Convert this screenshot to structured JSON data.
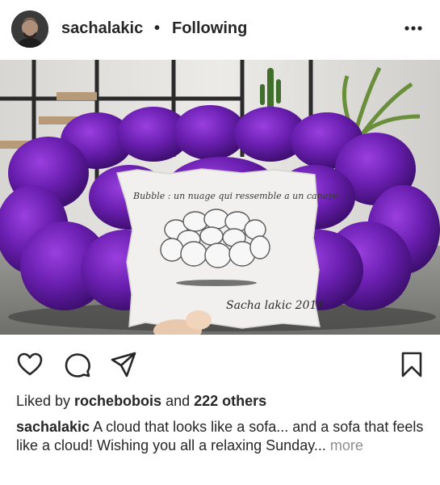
{
  "post": {
    "username": "sachalakic",
    "separator": "•",
    "follow_status": "Following",
    "more_icon": "ellipsis-icon",
    "image_handwriting": "Bubble : un nuage qui ressemble a un canapé ...",
    "image_signature": "Sacha lakic 2014"
  },
  "actions": {
    "like_icon": "heart-icon",
    "comment_icon": "comment-icon",
    "share_icon": "send-icon",
    "save_icon": "bookmark-icon"
  },
  "likes": {
    "prefix": "Liked by ",
    "user": "rochebobois",
    "middle": " and ",
    "others": "222 others"
  },
  "caption": {
    "user": "sachalakic",
    "text": " A cloud that looks like a sofa... and a sofa that feels like a cloud! Wishing you all a relaxing Sunday...",
    "more": "more"
  },
  "colors": {
    "text": "#262626",
    "muted": "#8e8e8e",
    "sofa_purple": "#6a1fb0"
  }
}
